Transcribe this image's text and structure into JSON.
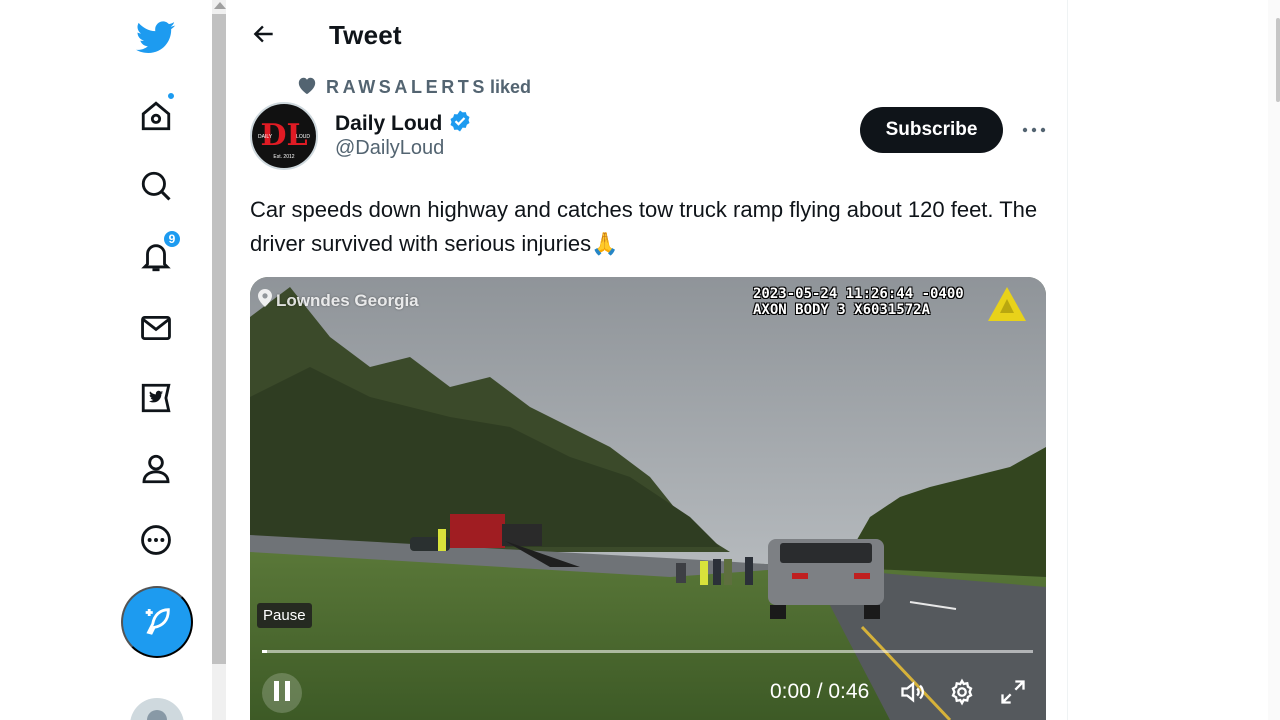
{
  "header": {
    "title": "Tweet"
  },
  "nav": {
    "items": [
      {
        "name": "twitter-logo"
      },
      {
        "name": "home"
      },
      {
        "name": "explore"
      },
      {
        "name": "notifications",
        "badge": "9"
      },
      {
        "name": "messages"
      },
      {
        "name": "twitter-blue"
      },
      {
        "name": "profile"
      },
      {
        "name": "more"
      }
    ]
  },
  "context": {
    "liker": "RAWSALERTS",
    "action": "liked"
  },
  "author": {
    "name": "Daily Loud",
    "handle": "@DailyLoud",
    "avatar_logo": "DL",
    "avatar_top_left": "DAILY",
    "avatar_top_right": "LOUD",
    "avatar_bottom": "Est. 2012"
  },
  "subscribe_label": "Subscribe",
  "tweet": {
    "text": "Car speeds down highway and catches tow truck ramp flying about 120 feet. The driver survived with serious injuries🙏"
  },
  "video": {
    "location": "Lowndes Georgia",
    "timestamp_line1": "2023-05-24 11:26:44 -0400",
    "timestamp_line2": "AXON BODY 3 X6031572A",
    "tooltip": "Pause",
    "time": "0:00 / 0:46",
    "progress": 0.006
  },
  "colors": {
    "accent": "#1d9bf0",
    "text": "#0f1419",
    "secondary": "#536471"
  }
}
